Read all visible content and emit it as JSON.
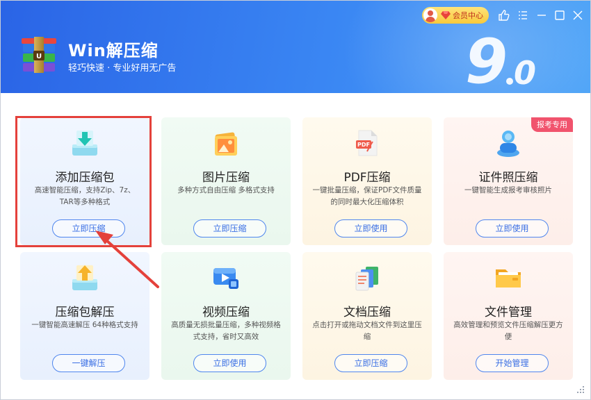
{
  "header": {
    "title": "Win解压缩",
    "subtitle": "轻巧快速 · 专业好用无广告",
    "version_major": "9",
    "version_minor": "0"
  },
  "vip": {
    "label": "会员中心"
  },
  "window_controls": [
    "like-icon",
    "menu-icon",
    "minimize-icon",
    "maximize-icon",
    "close-icon"
  ],
  "colors": {
    "header_start": "#2a64e6",
    "header_end": "#4aa2f7",
    "accent": "#3a6fe4",
    "highlight": "#e4413b",
    "badge": "#f1536d"
  },
  "cards": [
    {
      "title": "添加压缩包",
      "desc": "高速智能压缩，支持Zip、7z、TAR等多种格式",
      "button": "立即压缩",
      "icon": "add-archive-icon"
    },
    {
      "title": "图片压缩",
      "desc": "多种方式自由压缩 多格式支持",
      "button": "立即压缩",
      "icon": "image-compress-icon"
    },
    {
      "title": "PDF压缩",
      "desc": "一键批量压缩，保证PDF文件质量的同时最大化压缩体积",
      "button": "立即使用",
      "icon": "pdf-icon"
    },
    {
      "title": "证件照压缩",
      "desc": "一键智能生成报考审核照片",
      "button": "立即使用",
      "icon": "id-photo-icon",
      "badge": "报考专用"
    },
    {
      "title": "压缩包解压",
      "desc": "一键智能高速解压 64种格式支持",
      "button": "一键解压",
      "icon": "extract-icon"
    },
    {
      "title": "视频压缩",
      "desc": "高质量无损批量压缩，多种视频格式支持，省时又高效",
      "button": "立即使用",
      "icon": "video-icon"
    },
    {
      "title": "文档压缩",
      "desc": "点击打开或拖动文档文件到这里压缩",
      "button": "立即压缩",
      "icon": "document-icon"
    },
    {
      "title": "文件管理",
      "desc": "高效管理和预览文件压缩解压更方便",
      "button": "开始管理",
      "icon": "folder-icon"
    }
  ]
}
